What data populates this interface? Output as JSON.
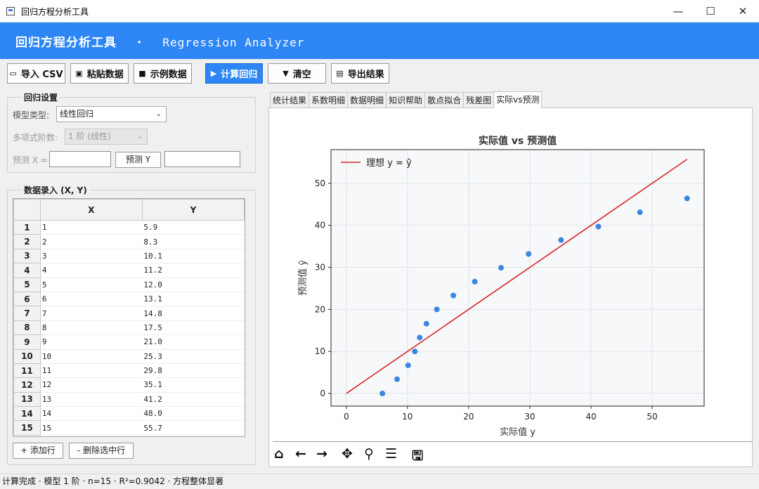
{
  "window": {
    "title": "回归方程分析工具"
  },
  "header": {
    "title_cn": "回归方程分析工具",
    "separator": "·",
    "title_en": "Regression Analyzer",
    "bg_color": "#2e86f5"
  },
  "toolbar": {
    "import_csv": "导入 CSV",
    "paste_data": "粘贴数据",
    "sample_data": "示例数据",
    "compute": "计算回归",
    "clear": "清空",
    "export": "导出结果"
  },
  "settings": {
    "group_label": "回归设置",
    "model_type_label": "模型类型:",
    "model_type_value": "线性回归",
    "degree_label": "多项式阶数:",
    "degree_value": "1 阶 (线性)",
    "predict_label": "预测 X =",
    "predict_button": "预测 Y"
  },
  "data_entry": {
    "group_label": "数据录入 (X, Y)",
    "columns": [
      "X",
      "Y"
    ],
    "rows": [
      {
        "n": "1",
        "x": "1",
        "y": "5.9"
      },
      {
        "n": "2",
        "x": "2",
        "y": "8.3"
      },
      {
        "n": "3",
        "x": "3",
        "y": "10.1"
      },
      {
        "n": "4",
        "x": "4",
        "y": "11.2"
      },
      {
        "n": "5",
        "x": "5",
        "y": "12.0"
      },
      {
        "n": "6",
        "x": "6",
        "y": "13.1"
      },
      {
        "n": "7",
        "x": "7",
        "y": "14.8"
      },
      {
        "n": "8",
        "x": "8",
        "y": "17.5"
      },
      {
        "n": "9",
        "x": "9",
        "y": "21.0"
      },
      {
        "n": "10",
        "x": "10",
        "y": "25.3"
      },
      {
        "n": "11",
        "x": "11",
        "y": "29.8"
      },
      {
        "n": "12",
        "x": "12",
        "y": "35.1"
      },
      {
        "n": "13",
        "x": "13",
        "y": "41.2"
      },
      {
        "n": "14",
        "x": "14",
        "y": "48.0"
      },
      {
        "n": "15",
        "x": "15",
        "y": "55.7"
      }
    ],
    "add_row": "+ 添加行",
    "delete_row": "- 删除选中行"
  },
  "tabs": [
    "统计结果",
    "系数明细",
    "数据明细",
    "知识帮助",
    "散点拟合",
    "残差图",
    "实际vs预测"
  ],
  "active_tab": 6,
  "chart_data": {
    "type": "scatter",
    "title": "实际值 vs 预测值",
    "xlabel": "实际值 y",
    "ylabel": "预测值 ŷ",
    "xlim": [
      -2.5,
      58.5
    ],
    "ylim": [
      -3,
      58
    ],
    "xticks": [
      0,
      10,
      20,
      30,
      40,
      50
    ],
    "yticks": [
      0,
      10,
      20,
      30,
      40,
      50
    ],
    "grid": true,
    "legend": "top-left",
    "series": [
      {
        "name": "理想 y = ŷ",
        "kind": "line",
        "color": "#d62728",
        "x": [
          0,
          55.7
        ],
        "y": [
          0,
          55.7
        ]
      },
      {
        "kind": "scatter",
        "color": "#3a86e0",
        "x": [
          5.9,
          8.3,
          10.1,
          11.2,
          12.0,
          13.1,
          14.8,
          17.5,
          21.0,
          25.3,
          29.8,
          35.1,
          41.2,
          48.0,
          55.7
        ],
        "y": [
          0.0,
          3.4,
          6.7,
          10.0,
          13.3,
          16.6,
          20.0,
          23.3,
          26.6,
          29.9,
          33.2,
          36.5,
          39.7,
          43.1,
          46.4
        ]
      }
    ]
  },
  "statusbar": {
    "text": "计算完成 · 模型 1 阶 · n=15 · R²=0.9042 · 方程整体显著"
  }
}
